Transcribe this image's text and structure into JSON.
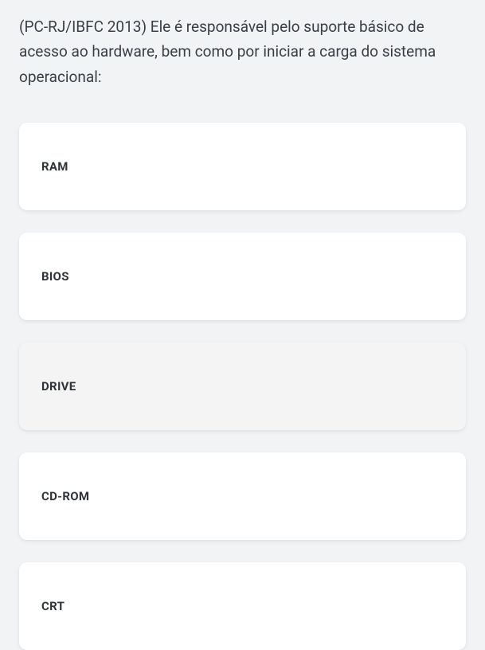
{
  "question": {
    "text": "(PC-RJ/IBFC 2013) Ele é responsável pelo suporte básico de acesso ao hardware, bem como por iniciar a carga do sistema operacional:"
  },
  "options": [
    {
      "label": "RAM"
    },
    {
      "label": "BIOS"
    },
    {
      "label": "DRIVE"
    },
    {
      "label": "CD-ROM"
    },
    {
      "label": "CRT"
    }
  ]
}
